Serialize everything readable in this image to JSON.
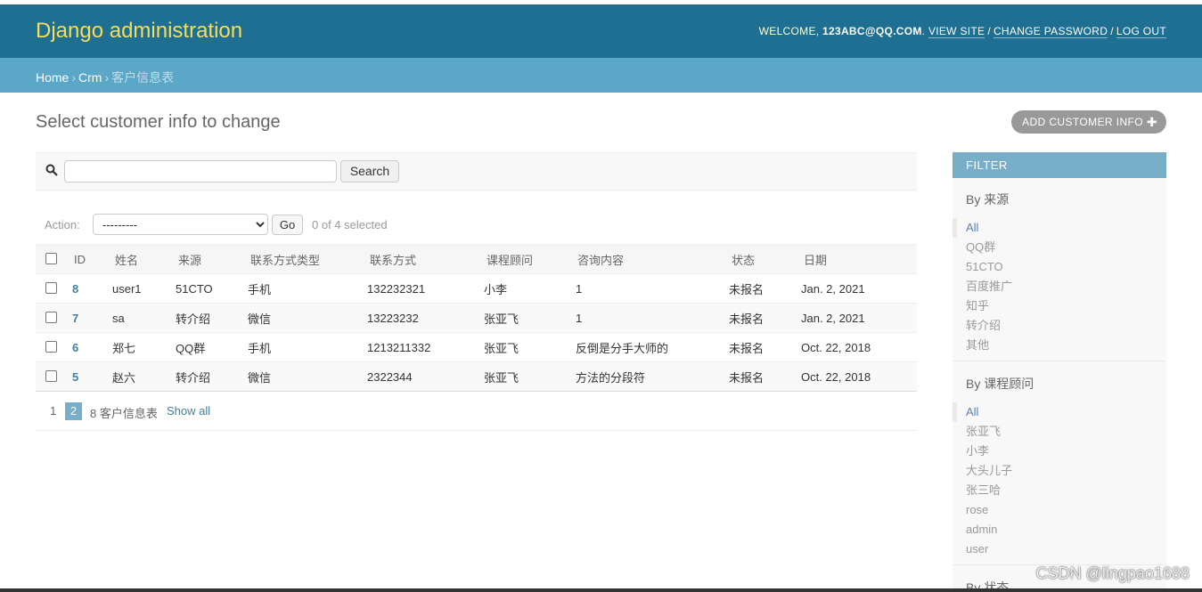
{
  "header": {
    "site_name": "Django administration",
    "welcome": "Welcome,",
    "username": "123abc@qq.com",
    "view_site": "View site",
    "change_password": "Change password",
    "log_out": "Log out"
  },
  "breadcrumbs": {
    "home": "Home",
    "app": "Crm",
    "current": "客户信息表"
  },
  "page": {
    "title": "Select customer info to change",
    "add_button": "Add customer info",
    "add_icon": "plus-icon"
  },
  "search": {
    "icon": "search-icon",
    "value": "",
    "button": "Search"
  },
  "actions": {
    "label": "Action:",
    "selected_option": "---------",
    "go": "Go",
    "counter": "0 of 4 selected"
  },
  "table": {
    "columns": [
      "ID",
      "姓名",
      "来源",
      "联系方式类型",
      "联系方式",
      "课程顾问",
      "咨询内容",
      "状态",
      "日期"
    ],
    "rows": [
      {
        "id": "8",
        "name": "user1",
        "source": "51CTO",
        "contact_type": "手机",
        "contact": "132232321",
        "consultant": "小李",
        "content": "1",
        "status": "未报名",
        "date": "Jan. 2, 2021"
      },
      {
        "id": "7",
        "name": "sa",
        "source": "转介绍",
        "contact_type": "微信",
        "contact": "13223232",
        "consultant": "张亚飞",
        "content": "1",
        "status": "未报名",
        "date": "Jan. 2, 2021"
      },
      {
        "id": "6",
        "name": "郑七",
        "source": "QQ群",
        "contact_type": "手机",
        "contact": "1213211332",
        "consultant": "张亚飞",
        "content": "反倒是分手大师的",
        "status": "未报名",
        "date": "Oct. 22, 2018"
      },
      {
        "id": "5",
        "name": "赵六",
        "source": "转介绍",
        "contact_type": "微信",
        "contact": "2322344",
        "consultant": "张亚飞",
        "content": "方法的分段符",
        "status": "未报名",
        "date": "Oct. 22, 2018"
      }
    ]
  },
  "paginator": {
    "page1": "1",
    "current_page": "2",
    "count": "8 客户信息表",
    "show_all": "Show all"
  },
  "filter": {
    "title": "Filter",
    "groups": [
      {
        "title": "By 来源",
        "items": [
          "All",
          "QQ群",
          "51CTO",
          "百度推广",
          "知乎",
          "转介绍",
          "其他"
        ]
      },
      {
        "title": "By 课程顾问",
        "items": [
          "All",
          "张亚飞",
          "小李",
          "大头儿子",
          "张三哈",
          "rose",
          "admin",
          "user"
        ]
      },
      {
        "title": "By 状态"
      }
    ]
  },
  "watermark": "CSDN @lingpao1688",
  "colors": {
    "header_bg": "#1e6f92",
    "breadcrumb_bg": "#5ba7c8",
    "branding": "#f5dd5d",
    "link": "#447e9b"
  }
}
